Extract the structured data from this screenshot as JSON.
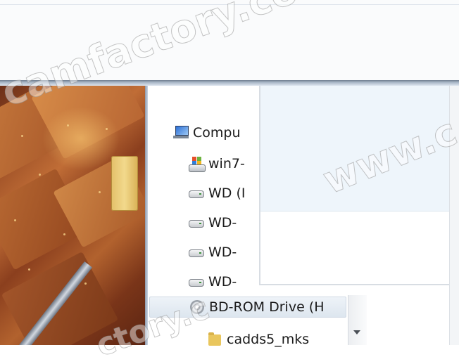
{
  "nav_items": [
    {
      "label": "Compu",
      "icon": "computer-icon"
    },
    {
      "label": "win7-",
      "icon": "windows-drive-icon"
    },
    {
      "label": "WD (I",
      "icon": "drive-icon"
    },
    {
      "label": "WD-",
      "icon": "drive-icon"
    },
    {
      "label": "WD-",
      "icon": "drive-icon"
    },
    {
      "label": "WD-",
      "icon": "drive-icon"
    },
    {
      "label": "BD-ROM Drive (H",
      "icon": "bd-rom-icon"
    },
    {
      "label": "cadds5_mks",
      "icon": "folder-icon"
    }
  ],
  "watermark": {
    "primary": "camfactory.com",
    "secondary": "www.c",
    "tertiary": "ctory.c"
  },
  "colors": {
    "selection": "#dde6ef",
    "frame": "#a9b6c6",
    "desktop": "#9a4d25"
  }
}
